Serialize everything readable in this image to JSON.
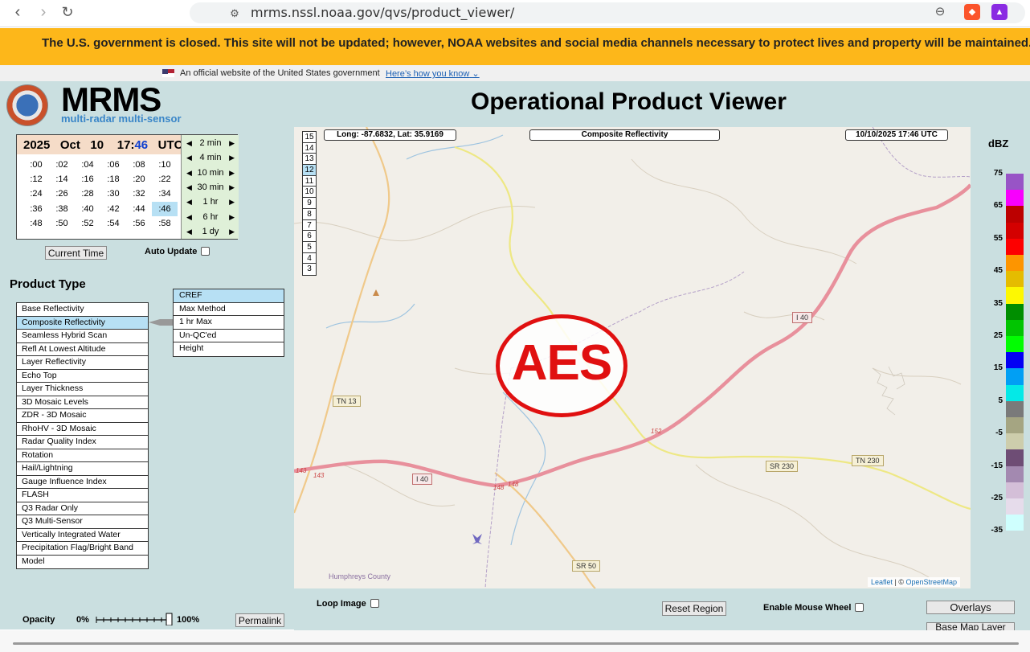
{
  "browser": {
    "url": "mrms.nssl.noaa.gov/qvs/product_viewer/",
    "back_icon": "back-arrow-icon",
    "forward_icon": "forward-arrow-icon",
    "reload_icon": "reload-icon"
  },
  "gov_banner": {
    "text": "The U.S. government is closed. This site will not be updated; however, NOAA websites and social media channels necessary to protect lives and property will be maintained. To le"
  },
  "official_bar": {
    "text": "An official website of the United States government",
    "link": "Here’s how you know"
  },
  "header": {
    "logo_title": "MRMS",
    "logo_subtitle": "multi-radar multi-sensor",
    "page_title": "Operational Product Viewer"
  },
  "time_panel": {
    "year": "2025",
    "month": "Oct",
    "day": "10",
    "hour": "17:",
    "minute": "46",
    "tz": "UTC",
    "minutes": [
      ":00",
      ":02",
      ":04",
      ":06",
      ":08",
      ":10",
      ":12",
      ":14",
      ":16",
      ":18",
      ":20",
      ":22",
      ":24",
      ":26",
      ":28",
      ":30",
      ":32",
      ":34",
      ":36",
      ":38",
      ":40",
      ":42",
      ":44",
      ":46",
      ":48",
      ":50",
      ":52",
      ":54",
      ":56",
      ":58"
    ],
    "selected_minute": ":46",
    "steps": [
      "2 min",
      "4 min",
      "10 min",
      "30 min",
      "1 hr",
      "6 hr",
      "1 dy"
    ],
    "current_time_label": "Current Time",
    "auto_update_label": "Auto Update"
  },
  "product_type": {
    "label": "Product Type",
    "items": [
      "Base Reflectivity",
      "Composite Reflectivity",
      "Seamless Hybrid Scan",
      "Refl At Lowest Altitude",
      "Layer Reflectivity",
      "Echo Top",
      "Layer Thickness",
      "3D Mosaic Levels",
      "ZDR - 3D Mosaic",
      "RhoHV - 3D Mosaic",
      "Radar Quality Index",
      "Rotation",
      "Hail/Lightning",
      "Gauge Influence Index",
      "FLASH",
      "Q3 Radar Only",
      "Q3 Multi-Sensor",
      "Vertically Integrated Water",
      "Precipitation Flag/Bright Band",
      "Model"
    ],
    "selected": "Composite Reflectivity",
    "sub_items": [
      "CREF",
      "Max Method",
      "1 hr Max",
      "Un-QC'ed",
      "Height"
    ],
    "selected_sub": "CREF"
  },
  "opacity": {
    "label": "Opacity",
    "min_label": "0%",
    "max_label": "100%",
    "value_percent": 100,
    "permalink_label": "Permalink"
  },
  "map": {
    "coords": "Long: -87.6832,  Lat: 35.9169",
    "product": "Composite Reflectivity",
    "datetime": "10/10/2025   17:46 UTC",
    "zoom_levels": [
      "15",
      "14",
      "13",
      "12",
      "11",
      "10",
      "9",
      "8",
      "7",
      "6",
      "5",
      "4",
      "3"
    ],
    "selected_zoom": "12",
    "road_labels": {
      "i40_east": "I 40",
      "i40_west": "I 40",
      "tn13": "TN 13",
      "sr230": "SR 230",
      "tn230": "TN 230",
      "sr50": "SR 50",
      "exit143a": "143",
      "exit143b": "143",
      "exit148a": "148",
      "exit148b": "148",
      "exit152": "152"
    },
    "county_label": "Humphreys County",
    "watermark": "AES",
    "attribution_leaflet": "Leaflet",
    "attribution_sep": " | © ",
    "attribution_osm": "OpenStreetMap"
  },
  "legend": {
    "title": "dBZ",
    "ticks": [
      "75",
      "65",
      "55",
      "45",
      "35",
      "25",
      "15",
      "5",
      "-5",
      "-15",
      "-25",
      "-35"
    ],
    "colors": [
      "#9854c6",
      "#f800fd",
      "#bc0000",
      "#d40000",
      "#fd0000",
      "#fd9500",
      "#e5bc00",
      "#fdf802",
      "#008e00",
      "#01c501",
      "#02fd02",
      "#0300f4",
      "#019ff4",
      "#04e9e7",
      "#7a7a7a",
      "#a5a582",
      "#cdcdac",
      "#6e4d75",
      "#a389b0",
      "#d4bfd8",
      "#e6dceb",
      "#cffffe"
    ]
  },
  "bottom_controls": {
    "loop_image_label": "Loop Image",
    "reset_region_label": "Reset Region",
    "mouse_wheel_label": "Enable Mouse Wheel",
    "overlays_label": "Overlays",
    "basemap_label": "Base Map Layer"
  }
}
